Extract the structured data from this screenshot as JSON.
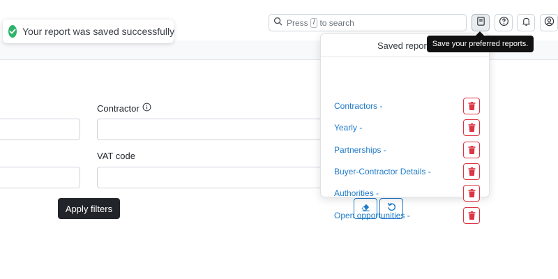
{
  "toast": {
    "message": "Your report was saved successfully"
  },
  "search": {
    "prefix": "Press",
    "key": "/",
    "suffix": "to search"
  },
  "tooltip": {
    "text": "Save your preferred reports."
  },
  "saved_reports": {
    "title": "Saved reports",
    "items": [
      {
        "label": "Contractors -"
      },
      {
        "label": "Yearly -"
      },
      {
        "label": "Partnerships -"
      },
      {
        "label": "Buyer-Contractor Details -"
      },
      {
        "label": "Authorities -"
      },
      {
        "label": "Open opportunities -"
      }
    ]
  },
  "filters": {
    "contractor_label": "Contractor",
    "vat_label": "VAT code",
    "apply_label": "Apply filters"
  },
  "colors": {
    "accent": "#1f7ac9",
    "danger": "#dc3545",
    "success": "#2fb36a"
  }
}
